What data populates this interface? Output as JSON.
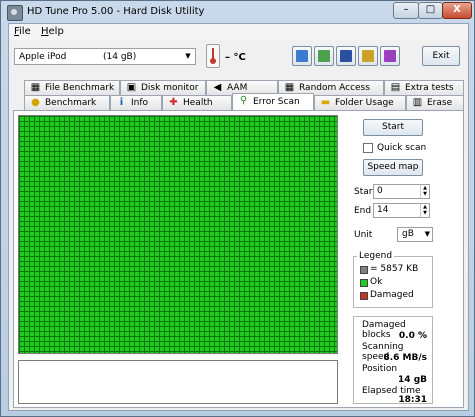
{
  "window": {
    "title": "HD Tune Pro 5.00 - Hard Disk Utility",
    "minimize": "–",
    "maximize": "□",
    "close": "X"
  },
  "menu": [
    {
      "label": "File",
      "accel": "F",
      "rest": "ile"
    },
    {
      "label": "Help",
      "accel": "H",
      "rest": "elp"
    }
  ],
  "toolbar": {
    "drive_name": "Apple  iPod",
    "drive_size": "(14 gB)",
    "temperature": "– °C",
    "buttons": [
      {
        "name": "info-copy-icon",
        "color": "#3b7bd0"
      },
      {
        "name": "copy-screenshot-icon",
        "color": "#4fa04f"
      },
      {
        "name": "save-icon",
        "color": "#2a4fa0"
      },
      {
        "name": "options-icon",
        "color": "#c9a227"
      },
      {
        "name": "download-icon",
        "color": "#9b3fc1"
      }
    ],
    "exit_label": "Exit"
  },
  "tabs_top": [
    {
      "label": "File Benchmark",
      "icon": "▦"
    },
    {
      "label": "Disk monitor",
      "icon": "▣"
    },
    {
      "label": "AAM",
      "icon": "◀"
    },
    {
      "label": "Random Access",
      "icon": "▦"
    },
    {
      "label": "Extra tests",
      "icon": "▤"
    }
  ],
  "tabs_bottom": [
    {
      "label": "Benchmark",
      "icon": "●"
    },
    {
      "label": "Info",
      "icon": "i"
    },
    {
      "label": "Health",
      "icon": "✚"
    },
    {
      "label": "Error Scan",
      "icon": "⚲"
    },
    {
      "label": "Folder Usage",
      "icon": "▬"
    },
    {
      "label": "Erase",
      "icon": "▥"
    }
  ],
  "error_scan": {
    "start_button": "Start",
    "quick_scan": "Quick scan",
    "quick_scan_checked": false,
    "speed_map_button": "Speed map",
    "start_label": "Start",
    "start_value": "0",
    "end_label": "End",
    "end_value": "14",
    "unit_label": "Unit",
    "unit_value": "gB",
    "legend": {
      "title": "Legend",
      "block": "= 5857 KB",
      "ok": "Ok",
      "damaged": "Damaged"
    },
    "stats": {
      "damaged_label": "Damaged blocks",
      "damaged_value": "0.0 %",
      "speed_label": "Scanning speed",
      "speed_value": "8.6 MB/s",
      "position_label": "Position",
      "position_value": "14 gB",
      "elapsed_label": "Elapsed time",
      "elapsed_value": "18:31"
    }
  },
  "colors": {
    "ok": "#1fcc1f",
    "damaged": "#c0392b",
    "block": "#808080"
  }
}
